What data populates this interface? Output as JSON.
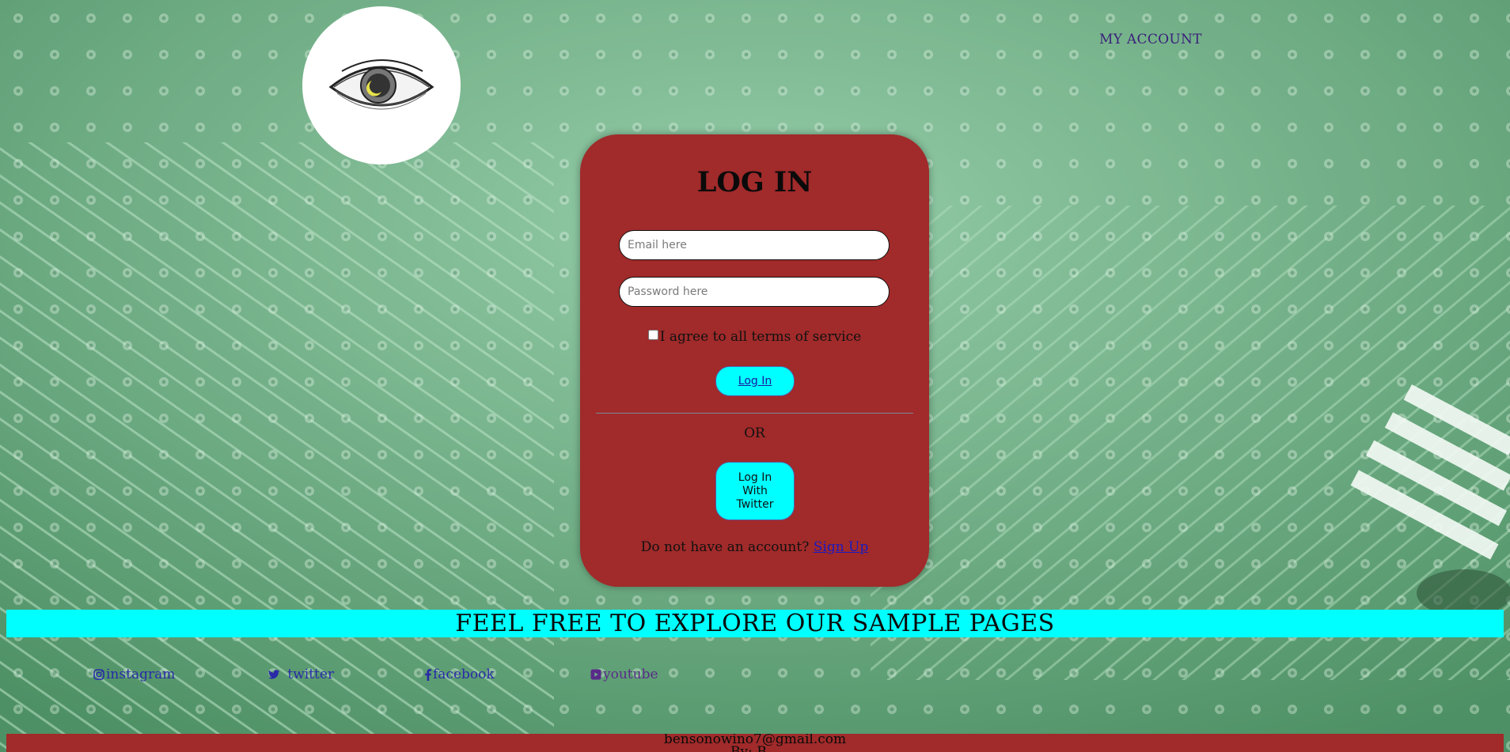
{
  "header": {
    "my_account": "MY ACCOUNT"
  },
  "login_card": {
    "title": "LOG IN",
    "email_placeholder": "Email here",
    "password_placeholder": "Password here",
    "terms_label": "I agree to all terms of service",
    "login_button": "Log In",
    "or_text": "OR",
    "twitter_button": "Log In With Twitter",
    "signup_prompt": "Do not have an account?",
    "signup_link": "Sign Up"
  },
  "banner": {
    "text": "FEEL FREE TO EXPLORE OUR SAMPLE PAGES"
  },
  "social": {
    "instagram": "instagram",
    "twitter": "twitter",
    "facebook": "facebook",
    "youtube": "youtube"
  },
  "footer": {
    "email": "bensonowino7@gmail.com",
    "byline": "By: B..."
  },
  "colors": {
    "card": "#a12a2a",
    "accent": "#00ffff",
    "background": "#6fae86"
  }
}
